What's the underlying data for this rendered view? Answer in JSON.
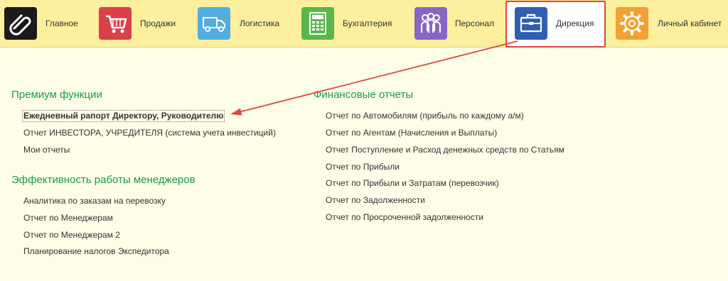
{
  "nav": {
    "items": [
      {
        "label": "Главное",
        "icon": "paperclip-logo-icon",
        "color": "#1b1b1b"
      },
      {
        "label": "Продажи",
        "icon": "shopping-cart-icon",
        "color": "#d9414a"
      },
      {
        "label": "Логистика",
        "icon": "truck-icon",
        "color": "#52aee0"
      },
      {
        "label": "Бухгалтерия",
        "icon": "calculator-icon",
        "color": "#58b84a"
      },
      {
        "label": "Персонал",
        "icon": "people-icon",
        "color": "#8a66c4"
      },
      {
        "label": "Дирекция",
        "icon": "briefcase-icon",
        "color": "#2f5fb0"
      },
      {
        "label": "Личный кабинет",
        "icon": "gear-icon",
        "color": "#f1a232"
      }
    ],
    "active": "Дирекция"
  },
  "sections": {
    "premium": {
      "title": "Премиум функции",
      "links": [
        "Ежедневный рапорт Директору, Руководителю",
        "Отчет ИНВЕСТОРА, УЧРЕДИТЕЛЯ (система учета инвестиций)",
        "Мои отчеты"
      ]
    },
    "managers": {
      "title": "Эффективность работы менеджеров",
      "links": [
        "Аналитика по заказам на перевозку",
        "Отчет по Менеджерам",
        "Отчет по Менеджерам 2",
        "Планирование налогов Экспедитора"
      ]
    },
    "finance": {
      "title": "Финансовые отчеты",
      "links": [
        "Отчет по Автомобилям (прибыль по каждому а/м)",
        "Отчет по Агентам (Начисления и Выплаты)",
        "Отчет Поступление и Расход денежных средств по Статьям",
        "Отчет по Прибыли",
        "Отчет по Прибыли и Затратам (перевозчик)",
        "Отчет по Задолженности",
        "Отчет по Просроченной задолженности"
      ]
    }
  },
  "annotation": {
    "color": "#e0473e"
  }
}
